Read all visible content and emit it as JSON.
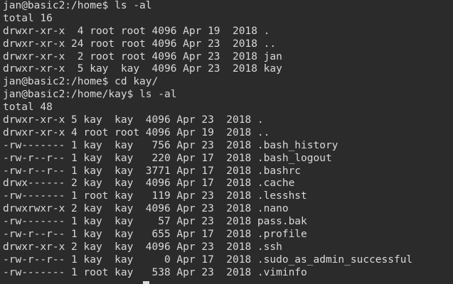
{
  "terminal": {
    "lines": [
      "jan@basic2:/home$ ls -al",
      "total 16",
      "drwxr-xr-x  4 root root 4096 Apr 19  2018 .",
      "drwxr-xr-x 24 root root 4096 Apr 23  2018 ..",
      "drwxr-xr-x  2 root root 4096 Apr 23  2018 jan",
      "drwxr-xr-x  5 kay  kay  4096 Apr 23  2018 kay",
      "jan@basic2:/home$ cd kay/",
      "jan@basic2:/home/kay$ ls -al",
      "total 48",
      "drwxr-xr-x 5 kay  kay  4096 Apr 23  2018 .",
      "drwxr-xr-x 4 root root 4096 Apr 19  2018 ..",
      "-rw------- 1 kay  kay   756 Apr 23  2018 .bash_history",
      "-rw-r--r-- 1 kay  kay   220 Apr 17  2018 .bash_logout",
      "-rw-r--r-- 1 kay  kay  3771 Apr 17  2018 .bashrc",
      "drwx------ 2 kay  kay  4096 Apr 17  2018 .cache",
      "-rw------- 1 root kay   119 Apr 23  2018 .lesshst",
      "drwxrwxr-x 2 kay  kay  4096 Apr 23  2018 .nano",
      "-rw------- 1 kay  kay    57 Apr 23  2018 pass.bak",
      "-rw-r--r-- 1 kay  kay   655 Apr 17  2018 .profile",
      "drwxr-xr-x 2 kay  kay  4096 Apr 23  2018 .ssh",
      "-rw-r--r-- 1 kay  kay     0 Apr 17  2018 .sudo_as_admin_successful",
      "-rw------- 1 root kay   538 Apr 23  2018 .viminfo"
    ]
  },
  "colors": {
    "background": "#2b2b2b",
    "foreground": "#d9d9d9"
  }
}
